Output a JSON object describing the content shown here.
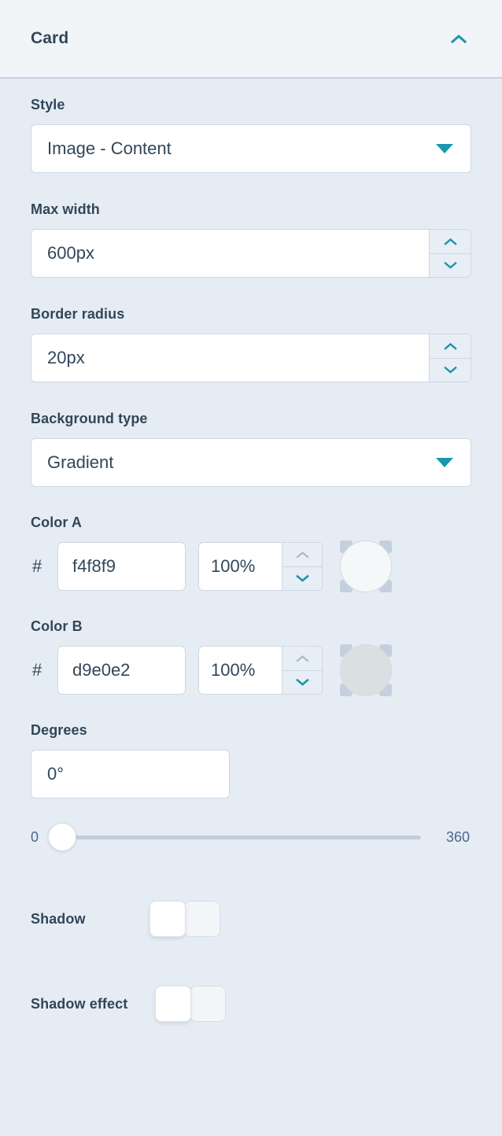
{
  "header": {
    "title": "Card",
    "collapse_icon": "chevron-up-icon"
  },
  "accent_color": "#1a96ad",
  "fields": {
    "style": {
      "label": "Style",
      "value": "Image - Content",
      "icon": "caret-down-icon"
    },
    "max_width": {
      "label": "Max width",
      "value": "600px",
      "stepper_up_icon": "chevron-up-icon",
      "stepper_down_icon": "chevron-down-icon"
    },
    "border_radius": {
      "label": "Border radius",
      "value": "20px",
      "stepper_up_icon": "chevron-up-icon",
      "stepper_down_icon": "chevron-down-icon"
    },
    "background_type": {
      "label": "Background type",
      "value": "Gradient",
      "icon": "caret-down-icon"
    },
    "color_a": {
      "label": "Color A",
      "hash_prefix": "#",
      "hex": "f4f8f9",
      "alpha": "100%",
      "swatch_color": "#f4f8f9",
      "stepper_up_icon": "chevron-up-icon",
      "stepper_down_icon": "chevron-down-icon"
    },
    "color_b": {
      "label": "Color B",
      "hash_prefix": "#",
      "hex": "d9e0e2",
      "alpha": "100%",
      "swatch_color": "#d9e0e2",
      "stepper_up_icon": "chevron-up-icon",
      "stepper_down_icon": "chevron-down-icon"
    },
    "degrees": {
      "label": "Degrees",
      "value": "0°",
      "slider_min": "0",
      "slider_max": "360",
      "slider_position_percent": 0
    },
    "shadow": {
      "label": "Shadow",
      "state": "off"
    },
    "shadow_effect": {
      "label": "Shadow effect",
      "state": "off"
    }
  }
}
